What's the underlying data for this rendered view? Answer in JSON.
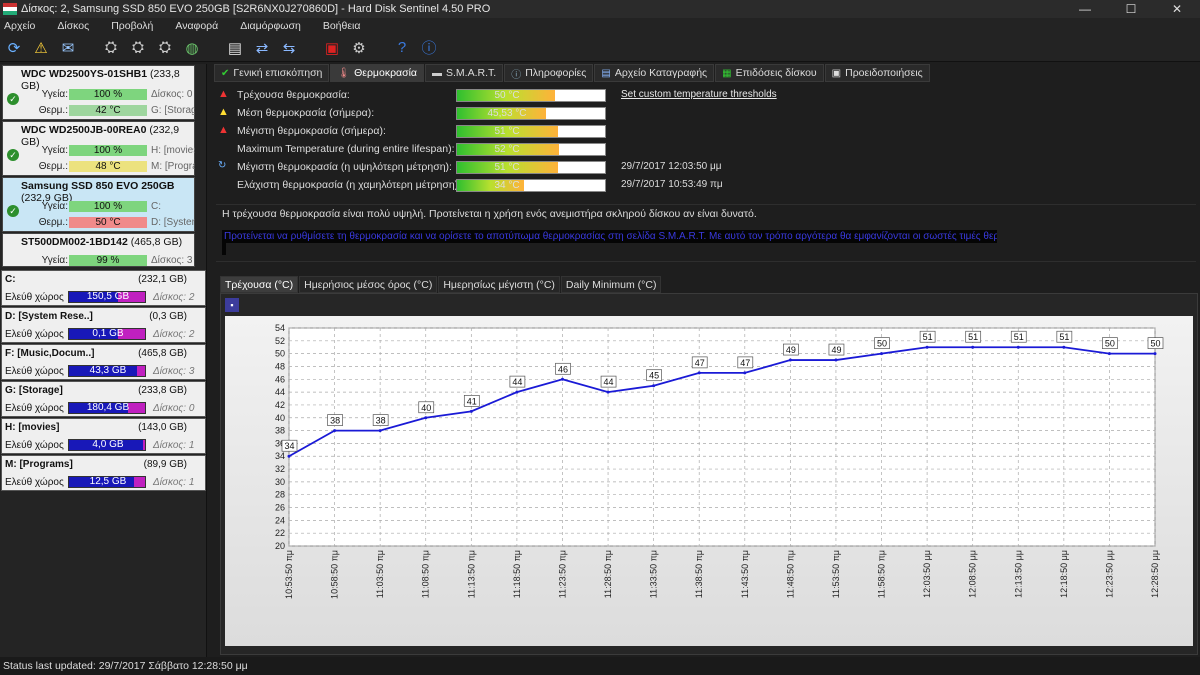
{
  "window": {
    "title": "Δίσκος: 2, Samsung SSD 850 EVO 250GB [S2R6NX0J270860D]  -  Hard Disk Sentinel 4.50 PRO",
    "min": "—",
    "max": "☐",
    "close": "✕"
  },
  "menu": [
    "Αρχείο",
    "Δίσκος",
    "Προβολή",
    "Αναφορά",
    "Διαμόρφωση",
    "Βοήθεια"
  ],
  "disks": [
    {
      "name": "WDC WD2500YS-01SHB1",
      "size": "(233,8 GB)",
      "health_label": "Υγεία:",
      "health": "100 %",
      "health_pct": 100,
      "health_extra": "Δίσκος: 0",
      "temp_label": "Θερμ.:",
      "temp": "42 °C",
      "temp_extra": "G: [Storage]",
      "temp_color": "#9ed69e"
    },
    {
      "name": "WDC WD2500JB-00REA0",
      "size": "(232,9 GB)",
      "health_label": "Υγεία:",
      "health": "100 %",
      "health_pct": 100,
      "health_extra": "H: [movies]",
      "temp_label": "Θερμ.:",
      "temp": "48 °C",
      "temp_extra": "M: [Programs]",
      "temp_color": "#ece27e"
    },
    {
      "name": "Samsung SSD 850 EVO 250GB",
      "size": "(232,9 GB)",
      "health_label": "Υγεία:",
      "health": "100 %",
      "health_pct": 100,
      "health_extra": "C:",
      "temp_label": "Θερμ.:",
      "temp": "50 °C",
      "temp_extra": "D: [System]",
      "temp_color": "#f08a8a"
    },
    {
      "name": "ST500DM002-1BD142",
      "size": "(465,8 GB)",
      "health_label": "Υγεία:",
      "health": "99 %",
      "health_pct": 99,
      "health_extra": "Δίσκος: 3"
    }
  ],
  "partitions": [
    {
      "name": "C:",
      "size": "(232,1 GB)",
      "free_label": "Ελεύθ χώρος",
      "free": "150,5 GB",
      "free_pct": 65,
      "disk": "Δίσκος: 2"
    },
    {
      "name": "D: [System Rese..]",
      "size": "(0,3 GB)",
      "free_label": "Ελεύθ χώρος",
      "free": "0,1 GB",
      "free_pct": 65,
      "disk": "Δίσκος: 2"
    },
    {
      "name": "F: [Music,Docum..]",
      "size": "(465,8 GB)",
      "free_label": "Ελεύθ χώρος",
      "free": "43,3 GB",
      "free_pct": 90,
      "disk": "Δίσκος: 3"
    },
    {
      "name": "G: [Storage]",
      "size": "(233,8 GB)",
      "free_label": "Ελεύθ χώρος",
      "free": "180,4 GB",
      "free_pct": 77,
      "disk": "Δίσκος: 0"
    },
    {
      "name": "H: [movies]",
      "size": "(143,0 GB)",
      "free_label": "Ελεύθ χώρος",
      "free": "4,0 GB",
      "free_pct": 97,
      "disk": "Δίσκος: 1"
    },
    {
      "name": "M: [Programs]",
      "size": "(89,9 GB)",
      "free_label": "Ελεύθ χώρος",
      "free": "12,5 GB",
      "free_pct": 86,
      "disk": "Δίσκος: 1"
    }
  ],
  "tabs": [
    "Γενική επισκόπηση",
    "Θερμοκρασία",
    "S.M.A.R.T.",
    "Πληροφορίες",
    "Αρχείο Καταγραφής",
    "Επιδόσεις δίσκου",
    "Προειδοποιήσεις"
  ],
  "temperatures": [
    {
      "label": "Τρέχουσα θερμοκρασία:",
      "value": "50 °C",
      "level": 0.66,
      "warn": "red"
    },
    {
      "label": "Μέση θερμοκρασία (σήμερα):",
      "value": "45,53 °C",
      "level": 0.6,
      "warn": "yellow"
    },
    {
      "label": "Μέγιστη θερμοκρασία (σήμερα):",
      "value": "51 °C",
      "level": 0.68,
      "warn": "red"
    },
    {
      "label": "Maximum Temperature (during entire lifespan):",
      "value": "52 °C",
      "level": 0.69,
      "warn": ""
    },
    {
      "label": "Μέγιστη θερμοκρασία (η υψηλότερη μέτρηση):",
      "value": "51 °C",
      "level": 0.68,
      "warn": "",
      "date": "29/7/2017 12:03:50 μμ"
    },
    {
      "label": "Ελάχιστη θερμοκρασία (η χαμηλότερη μέτρηση):",
      "value": "34 °C",
      "level": 0.45,
      "warn": "",
      "date": "29/7/2017 10:53:49 πμ"
    }
  ],
  "threshold_link": "Set custom temperature thresholds",
  "info": {
    "line1": "Η τρέχουσα θερμοκρασία είναι πολύ υψηλή. Προτείνεται η χρήση ενός ανεμιστήρα σκληρού δίσκου αν είναι δυνατό.",
    "line2": "Προτείνεται να ρυθμίσετε τη θερμοκρασία και να ορίσετε το αποτύπωμα θερμοκρασίας στη σελίδα S.M.A.R.T. Με αυτό τον τρόπο αργότερα θα εμφανίζονται οι σωστές τιμές θερμοκρασίας."
  },
  "chart_tabs": [
    "Τρέχουσα (°C)",
    "Ημερήσιος μέσος όρος (°C)",
    "Ημερησίως μέγιστη (°C)",
    "Daily Minimum (°C)"
  ],
  "chart_data": {
    "type": "line",
    "x": [
      "10:53:50 πμ",
      "10:58:50 πμ",
      "11:03:50 πμ",
      "11:08:50 πμ",
      "11:13:50 πμ",
      "11:18:50 πμ",
      "11:23:50 πμ",
      "11:28:50 πμ",
      "11:33:50 πμ",
      "11:38:50 πμ",
      "11:43:50 πμ",
      "11:48:50 πμ",
      "11:53:50 πμ",
      "11:58:50 πμ",
      "12:03:50 μμ",
      "12:08:50 μμ",
      "12:13:50 μμ",
      "12:18:50 μμ",
      "12:23:50 μμ",
      "12:28:50 μμ"
    ],
    "values": [
      34,
      38,
      38,
      40,
      41,
      44,
      46,
      44,
      45,
      47,
      47,
      49,
      49,
      50,
      51,
      51,
      51,
      51,
      50,
      50
    ],
    "ylim": [
      20,
      54
    ],
    "yticks": [
      20,
      22,
      24,
      26,
      28,
      30,
      32,
      34,
      36,
      38,
      40,
      42,
      44,
      46,
      48,
      50,
      52,
      54
    ],
    "grid": true,
    "line_color": "#1a1ad6"
  },
  "status": "Status last updated: 29/7/2017 Σάββατο 12:28:50 μμ"
}
